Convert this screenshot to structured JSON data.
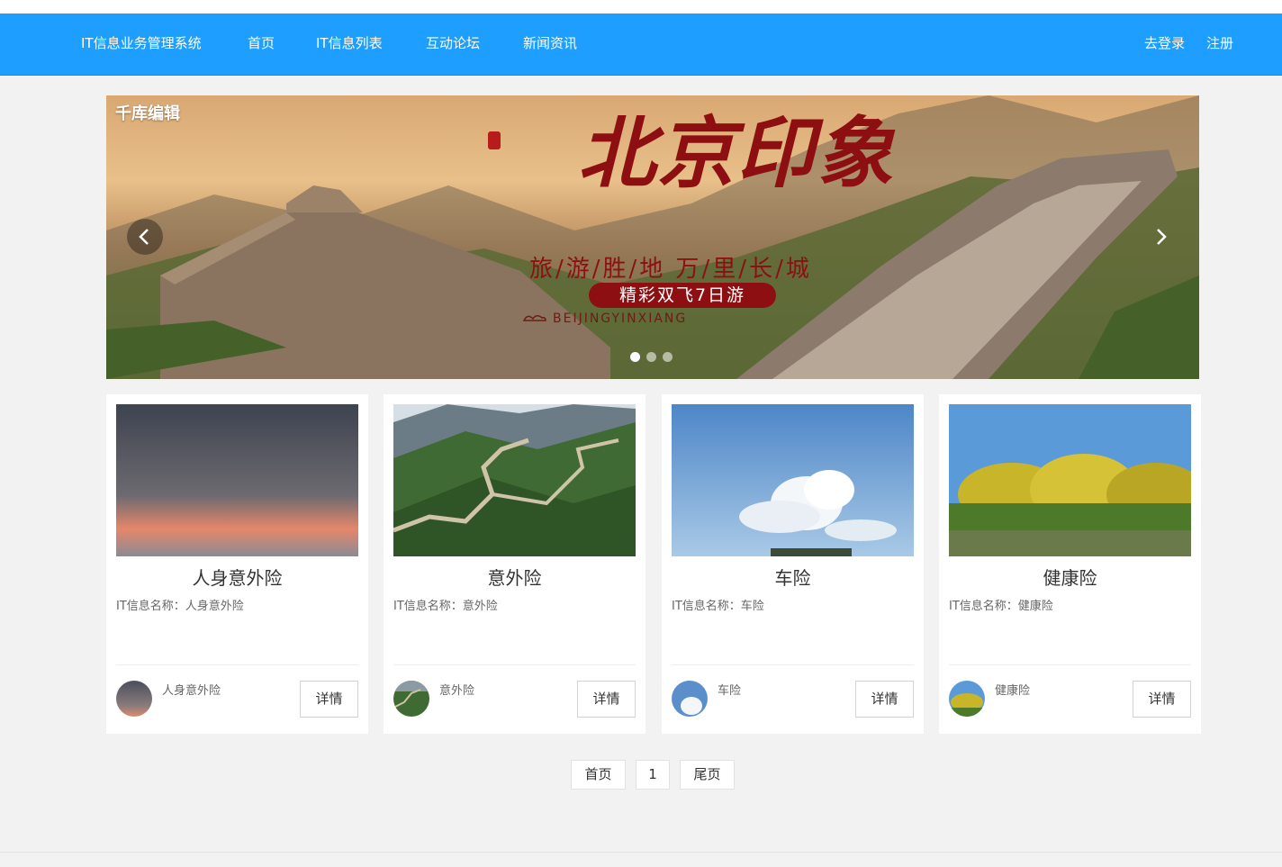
{
  "nav": {
    "brand": "IT信息业务管理系统",
    "items": [
      "首页",
      "IT信息列表",
      "互动论坛",
      "新闻资讯"
    ],
    "login": "去登录",
    "register": "注册"
  },
  "banner": {
    "watermark": "千库编辑",
    "title": "北京印象",
    "seal": "象",
    "subtitle": "BEIJINGYINXIANG",
    "tagline": "旅/游/胜/地 万/里/长/城",
    "pill": "精彩双飞7日游",
    "prev_icon": "chevron-left-icon",
    "next_icon": "chevron-right-icon",
    "slides": 3,
    "active_slide": 1
  },
  "cards": [
    {
      "title": "人身意外险",
      "info_label": "IT信息名称：",
      "info_value": "人身意外险",
      "author": "人身意外险",
      "button": "详情"
    },
    {
      "title": "意外险",
      "info_label": "IT信息名称：",
      "info_value": "意外险",
      "author": "意外险",
      "button": "详情"
    },
    {
      "title": "车险",
      "info_label": "IT信息名称：",
      "info_value": "车险",
      "author": "车险",
      "button": "详情"
    },
    {
      "title": "健康险",
      "info_label": "IT信息名称：",
      "info_value": "健康险",
      "author": "健康险",
      "button": "详情"
    }
  ],
  "pagination": {
    "first": "首页",
    "current": "1",
    "last": "尾页"
  },
  "colors": {
    "nav_bg": "#1e9fff",
    "page_bg": "#f2f2f2",
    "banner_red": "#8e0f12"
  }
}
